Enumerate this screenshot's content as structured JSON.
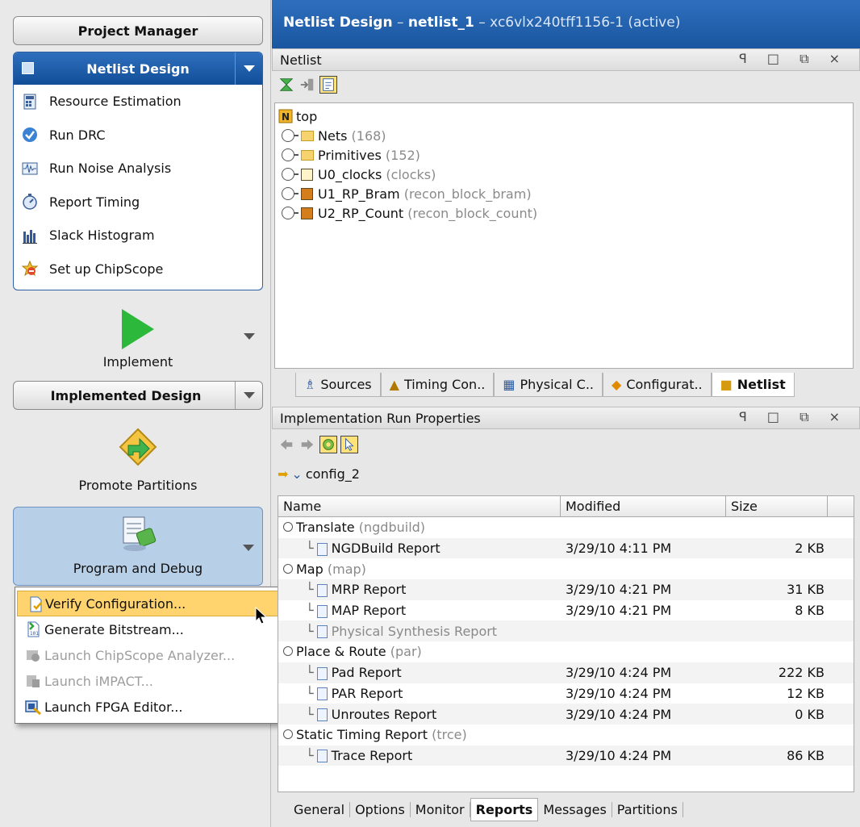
{
  "window": {
    "title": "Netlist Design",
    "title_sep": " – ",
    "title_name": "netlist_1",
    "title_detail": " – xc6vlx240tff1156-1 (active)"
  },
  "nav": {
    "project_manager": "Project Manager",
    "netlist_design": {
      "title": "Netlist Design",
      "tasks": [
        {
          "label": "Resource Estimation",
          "icon": "calculator-icon"
        },
        {
          "label": "Run DRC",
          "icon": "check-circle-icon"
        },
        {
          "label": "Run Noise Analysis",
          "icon": "waveform-icon"
        },
        {
          "label": "Report Timing",
          "icon": "stopwatch-icon"
        },
        {
          "label": "Slack Histogram",
          "icon": "histogram-icon"
        },
        {
          "label": "Set up ChipScope",
          "icon": "chipscope-icon"
        }
      ]
    },
    "implement": "Implement",
    "implemented_design": "Implemented Design",
    "promote_partitions": "Promote Partitions",
    "program_and_debug": "Program and Debug"
  },
  "menu": {
    "items": [
      {
        "label": "Verify Configuration...",
        "icon": "verify-icon",
        "enabled": true,
        "highlighted": true
      },
      {
        "label": "Generate Bitstream...",
        "icon": "bitstream-icon",
        "enabled": true
      },
      {
        "label": "Launch ChipScope Analyzer...",
        "icon": "chipscope-analyzer-icon",
        "enabled": false
      },
      {
        "label": "Launch iMPACT...",
        "icon": "impact-icon",
        "enabled": false
      },
      {
        "label": "Launch FPGA Editor...",
        "icon": "fpga-editor-icon",
        "enabled": true
      }
    ]
  },
  "netlist_panel": {
    "title": "Netlist",
    "window_buttons": "ꟼ □ ⧉ ×",
    "root": "top",
    "nodes": [
      {
        "name": "Nets",
        "detail": "(168)",
        "icon": "folder-icon"
      },
      {
        "name": "Primitives",
        "detail": "(152)",
        "icon": "folder-icon"
      },
      {
        "name": "U0_clocks",
        "detail": "(clocks)",
        "icon": "module-icon"
      },
      {
        "name": "U1_RP_Bram",
        "detail": "(recon_block_bram)",
        "icon": "partition-icon"
      },
      {
        "name": "U2_RP_Count",
        "detail": "(recon_block_count)",
        "icon": "partition-icon"
      }
    ],
    "tabs": [
      {
        "label": "Sources",
        "active": false
      },
      {
        "label": "Timing Con..",
        "active": false
      },
      {
        "label": "Physical C..",
        "active": false
      },
      {
        "label": "Configurat..",
        "active": false
      },
      {
        "label": "Netlist",
        "active": true
      }
    ]
  },
  "impl_panel": {
    "title": "Implementation Run Properties",
    "window_buttons": "ꟼ □ ⧉ ×",
    "run_name": "config_2",
    "columns": [
      "Name",
      "Modified",
      "Size"
    ],
    "rows": [
      {
        "indent": 0,
        "name": "Translate",
        "detail": "(ngdbuild)",
        "modified": "",
        "size": ""
      },
      {
        "indent": 1,
        "name": "NGDBuild Report",
        "detail": "",
        "modified": "3/29/10 4:11 PM",
        "size": "2 KB"
      },
      {
        "indent": 0,
        "name": "Map",
        "detail": "(map)",
        "modified": "",
        "size": ""
      },
      {
        "indent": 1,
        "name": "MRP Report",
        "detail": "",
        "modified": "3/29/10 4:21 PM",
        "size": "31 KB"
      },
      {
        "indent": 1,
        "name": "MAP Report",
        "detail": "",
        "modified": "3/29/10 4:21 PM",
        "size": "8 KB"
      },
      {
        "indent": 1,
        "name": "Physical Synthesis Report",
        "detail": "",
        "modified": "",
        "size": "",
        "disabled": true
      },
      {
        "indent": 0,
        "name": "Place & Route",
        "detail": "(par)",
        "modified": "",
        "size": ""
      },
      {
        "indent": 1,
        "name": "Pad Report",
        "detail": "",
        "modified": "3/29/10 4:24 PM",
        "size": "222 KB"
      },
      {
        "indent": 1,
        "name": "PAR Report",
        "detail": "",
        "modified": "3/29/10 4:24 PM",
        "size": "12 KB"
      },
      {
        "indent": 1,
        "name": "Unroutes Report",
        "detail": "",
        "modified": "3/29/10 4:24 PM",
        "size": "0 KB"
      },
      {
        "indent": 0,
        "name": "Static Timing Report",
        "detail": "(trce)",
        "modified": "",
        "size": ""
      },
      {
        "indent": 1,
        "name": "Trace Report",
        "detail": "",
        "modified": "3/29/10 4:24 PM",
        "size": "86 KB"
      }
    ],
    "tabs": [
      {
        "label": "General",
        "active": false
      },
      {
        "label": "Options",
        "active": false
      },
      {
        "label": "Monitor",
        "active": false
      },
      {
        "label": "Reports",
        "active": true
      },
      {
        "label": "Messages",
        "active": false
      },
      {
        "label": "Partitions",
        "active": false
      }
    ]
  }
}
